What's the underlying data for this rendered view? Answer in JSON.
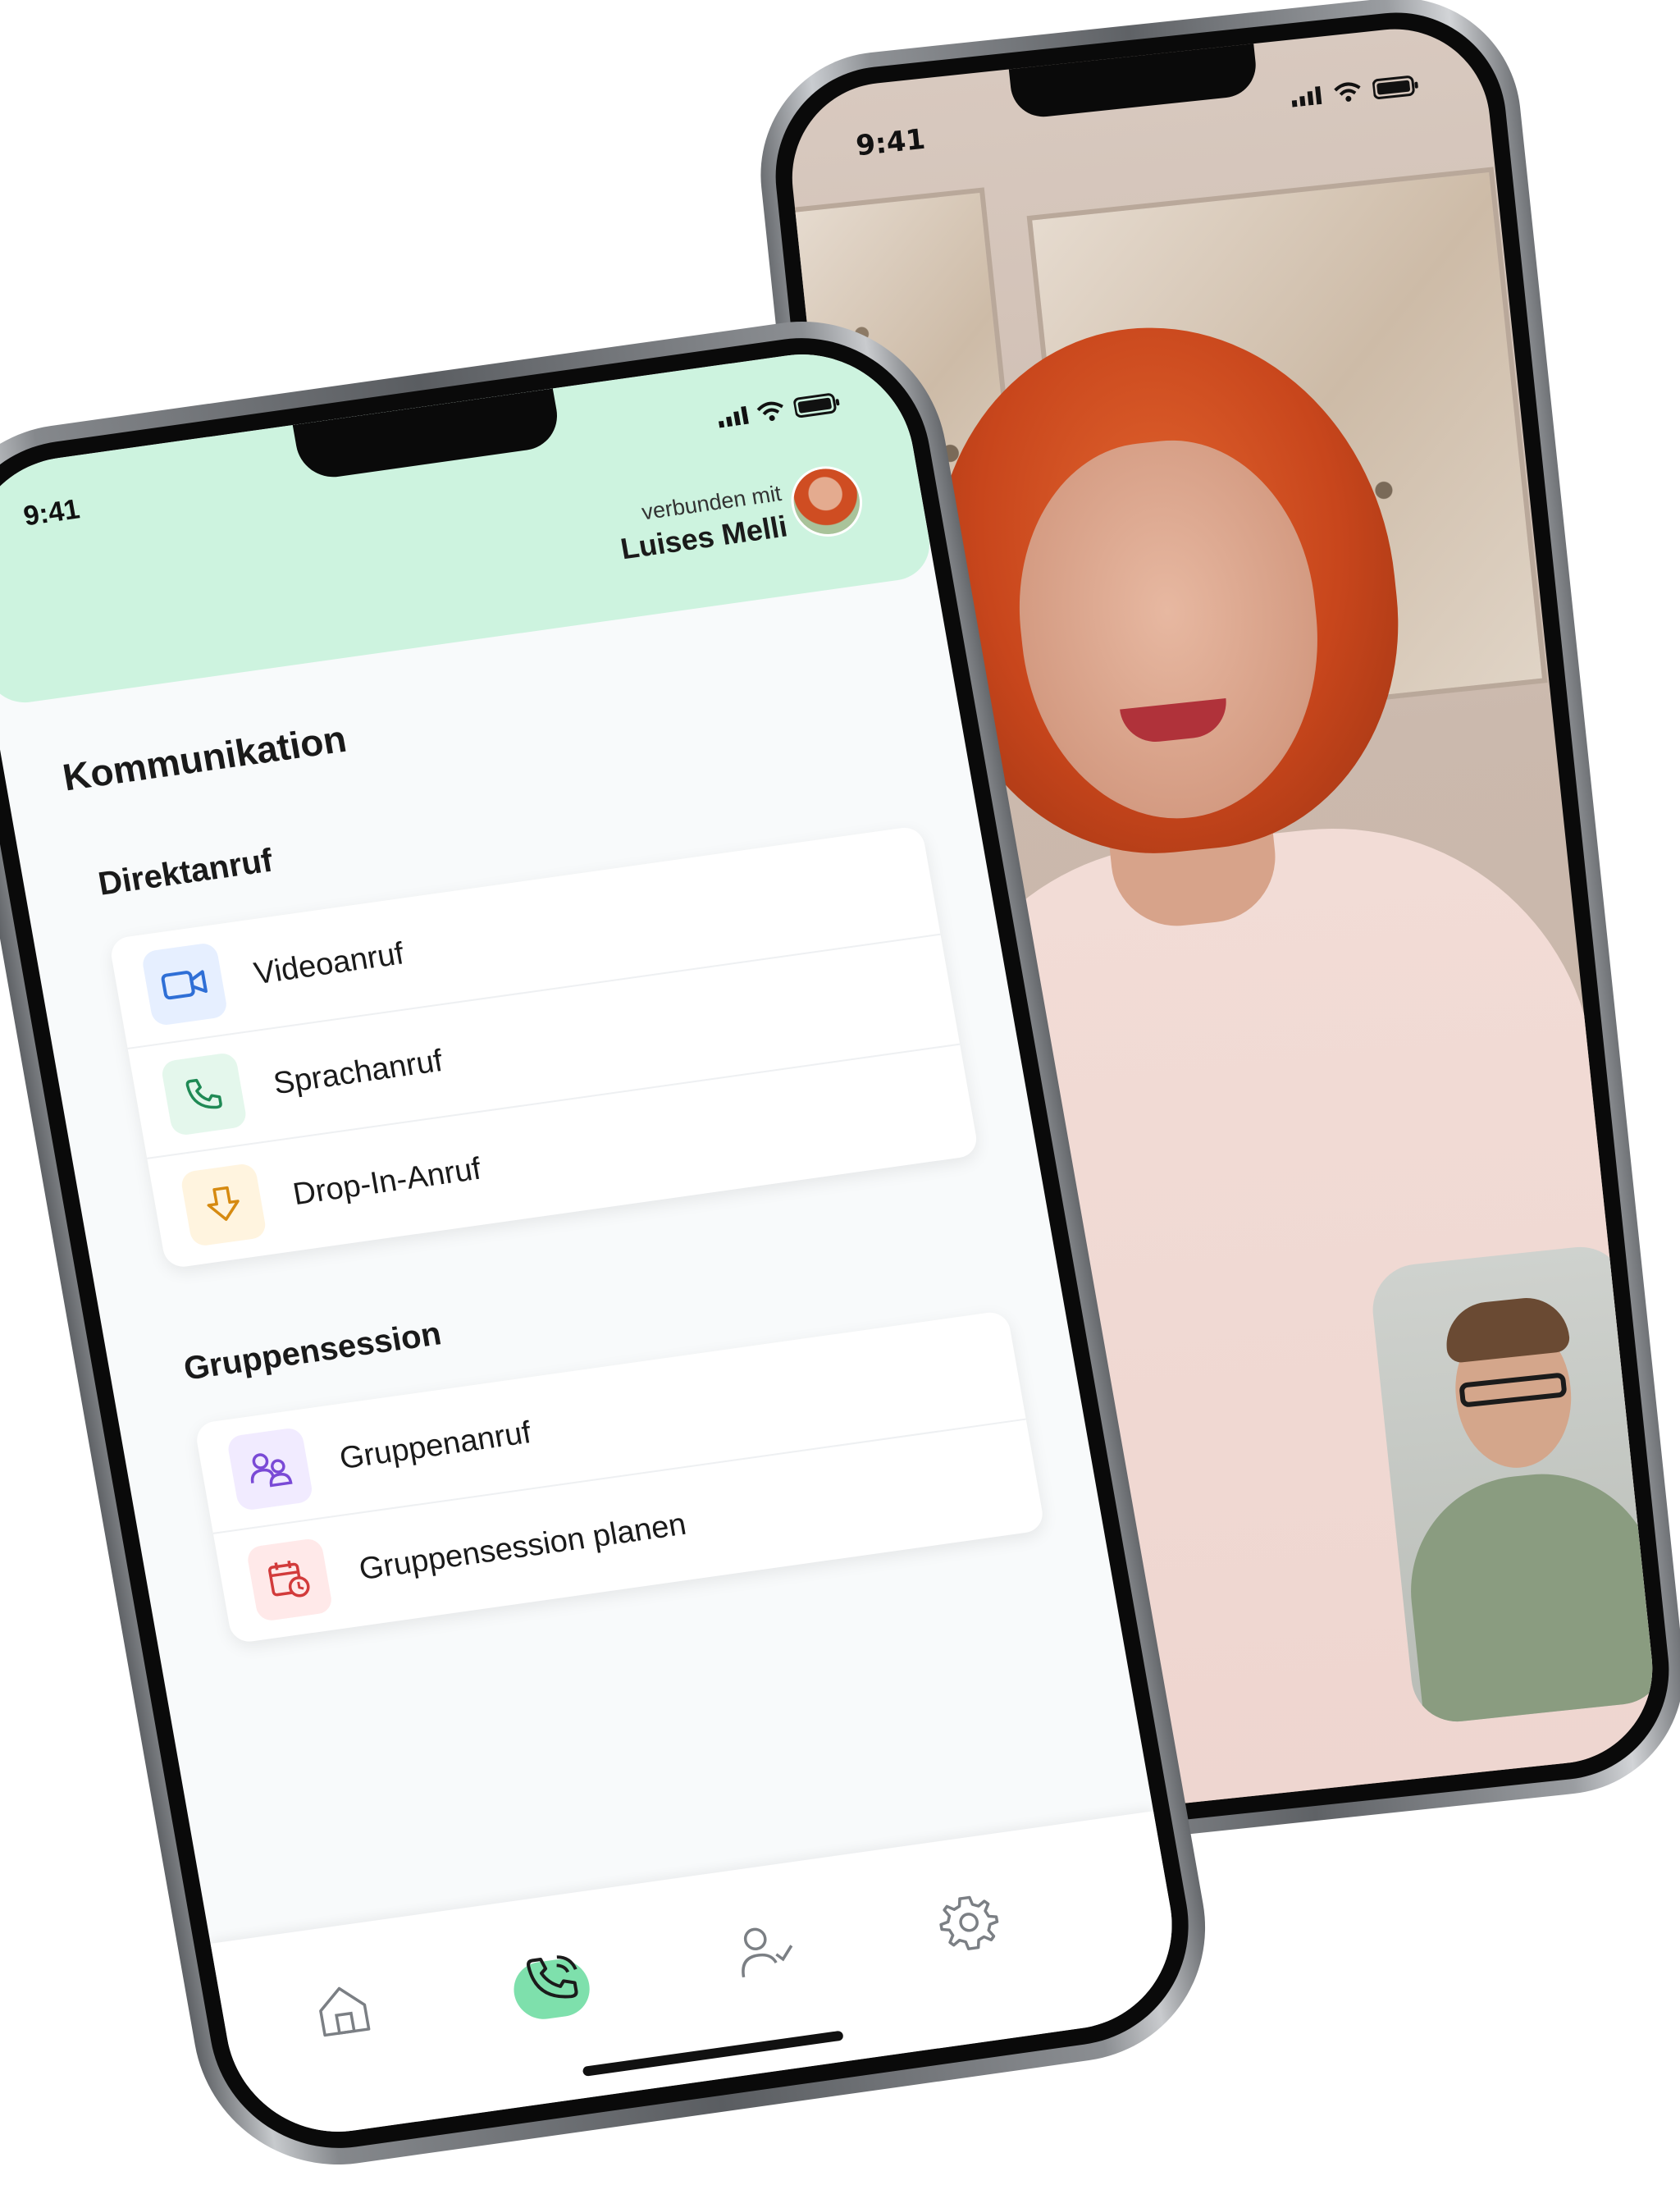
{
  "back_phone": {
    "status_time": "9:41"
  },
  "front_phone": {
    "status_time": "9:41",
    "connection": {
      "label": "verbunden mit",
      "name": "Luises Melli"
    },
    "page_title": "Kommunikation",
    "sections": [
      {
        "title": "Direktanruf",
        "items": [
          {
            "label": "Videoanruf",
            "icon": "video-camera-icon",
            "icon_color": "#2f6fd6",
            "icon_bg": "#e6efff"
          },
          {
            "label": "Sprachanruf",
            "icon": "phone-icon",
            "icon_color": "#1f8a55",
            "icon_bg": "#e4f7ec"
          },
          {
            "label": "Drop-In-Anruf",
            "icon": "arrow-down-icon",
            "icon_color": "#d68a11",
            "icon_bg": "#fff4df"
          }
        ]
      },
      {
        "title": "Gruppensession",
        "items": [
          {
            "label": "Gruppenanruf",
            "icon": "group-icon",
            "icon_color": "#7a4ad6",
            "icon_bg": "#f1ebff"
          },
          {
            "label": "Gruppensession planen",
            "icon": "calendar-clock-icon",
            "icon_color": "#d23b3b",
            "icon_bg": "#ffe9e9"
          }
        ]
      }
    ],
    "tabbar": [
      {
        "icon": "home-icon",
        "active": false
      },
      {
        "icon": "phone-icon",
        "active": true
      },
      {
        "icon": "user-check-icon",
        "active": false
      },
      {
        "icon": "gear-icon",
        "active": false
      }
    ],
    "accent_color": "#cdf3df"
  }
}
